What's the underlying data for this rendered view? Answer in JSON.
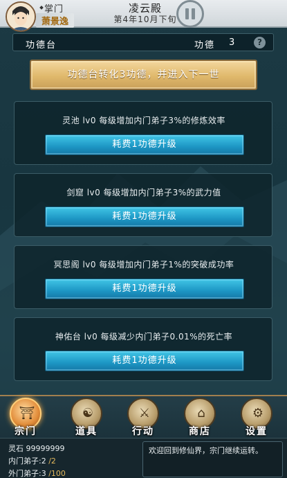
{
  "top_bar": {
    "role": "掌门",
    "player_name": "萧景逸",
    "hall_name": "凌云殿",
    "date": "第4年10月下旬"
  },
  "merit": {
    "title": "功德台",
    "count_label": "功德",
    "count_value": "3",
    "help_icon": "?",
    "convert_button": "功德台转化3功德，并进入下一世"
  },
  "upgrades": [
    {
      "desc": "灵池 lv0 每级增加内门弟子3%的修炼效率",
      "button": "耗费1功德升级"
    },
    {
      "desc": "剑窟 lv0 每级增加内门弟子3%的武力值",
      "button": "耗费1功德升级"
    },
    {
      "desc": "冥思阁 lv0 每级增加内门弟子1%的突破成功率",
      "button": "耗费1功德升级"
    },
    {
      "desc": "神佑台 lv0 每级减少内门弟子0.01%的死亡率",
      "button": "耗费1功德升级"
    }
  ],
  "nav": [
    {
      "label": "宗门",
      "icon": "sect-gate-icon",
      "glyph": "⛩",
      "active": true
    },
    {
      "label": "道具",
      "icon": "money-bag-icon",
      "glyph": "☯",
      "active": false
    },
    {
      "label": "行动",
      "icon": "sword-icon",
      "glyph": "⚔",
      "active": false
    },
    {
      "label": "商店",
      "icon": "shop-icon",
      "glyph": "⌂",
      "active": false
    },
    {
      "label": "设置",
      "icon": "gear-icon",
      "glyph": "⚙",
      "active": false
    }
  ],
  "resources": {
    "stone_label": "灵石",
    "stone_value": "99999999",
    "inner_label": "内门弟子:",
    "inner_current": "2",
    "inner_max": "/2",
    "outer_label": "外门弟子:",
    "outer_current": "3",
    "outer_max": "/100"
  },
  "message": "欢迎回到修仙界，宗门继续运转。"
}
